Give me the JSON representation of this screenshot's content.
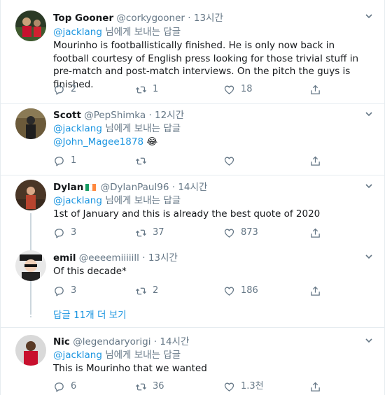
{
  "tweets": [
    {
      "name": "Top Gooner",
      "handle": "@corkygooner",
      "time": "13시간",
      "reply_to_handle": "@jacklang",
      "reply_to_suffix": " 님에게 보내는 답글",
      "text": "Mourinho is footballistically finished. He is only now back in football courtesy of English press looking for those trivial stuff in pre-match and post-match interviews. On the pitch the guys is finished.",
      "replies": "2",
      "retweets": "1",
      "likes": "18"
    },
    {
      "name": "Scott",
      "handle": "@PepShimka",
      "time": "12시간",
      "reply_to_handle": "@jacklang",
      "reply_to_suffix": " 님에게 보내는 답글",
      "mention": "@John_Magee1878",
      "emoji": "😂",
      "replies": "1",
      "retweets": "",
      "likes": ""
    },
    {
      "name": "Dylan",
      "handle": "@DylanPaul96",
      "time": "14시간",
      "reply_to_handle": "@jacklang",
      "reply_to_suffix": " 님에게 보내는 답글",
      "text": "1st of January and this is already the best quote of 2020",
      "replies": "3",
      "retweets": "37",
      "likes": "873"
    },
    {
      "name": "emil",
      "handle": "@eeeemiiiiill",
      "time": "13시간",
      "text": "Of this decade*",
      "replies": "3",
      "retweets": "2",
      "likes": "186"
    },
    {
      "name": "Nic",
      "handle": "@legendaryorigi",
      "time": "14시간",
      "reply_to_handle": "@jacklang",
      "reply_to_suffix": " 님에게 보내는 답글",
      "text": "This is Mourinho that we wanted",
      "replies": "6",
      "retweets": "36",
      "likes": "1.3천"
    }
  ],
  "dot": "·",
  "show_more_replies": "답글 11개 더 보기",
  "colors": {
    "link": "#1b95e0",
    "secondary": "#657786",
    "border": "#e6ecf0"
  },
  "icons": [
    "caret-down-icon",
    "reply-icon",
    "retweet-icon",
    "like-icon",
    "share-icon",
    "flag-ireland-icon"
  ]
}
